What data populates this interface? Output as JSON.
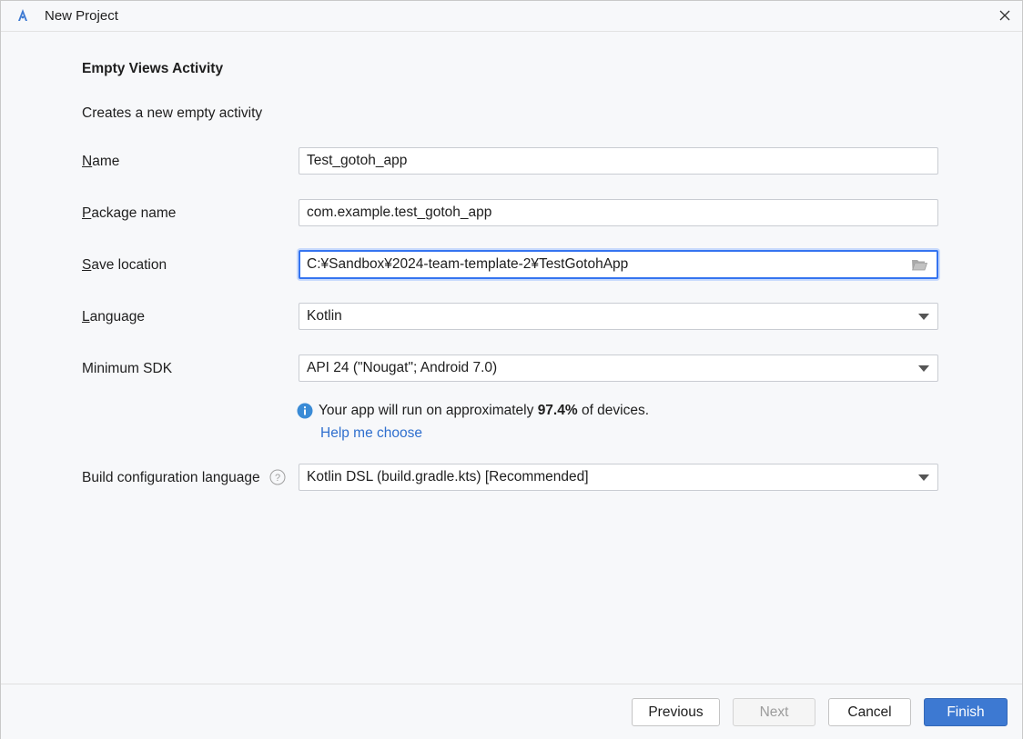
{
  "window": {
    "title": "New Project"
  },
  "content": {
    "heading": "Empty Views Activity",
    "description": "Creates a new empty activity"
  },
  "form": {
    "name": {
      "label_mnemonic": "N",
      "label_rest": "ame",
      "value": "Test_gotoh_app"
    },
    "package": {
      "label_mnemonic": "P",
      "label_rest": "ackage name",
      "value": "com.example.test_gotoh_app"
    },
    "save_location": {
      "label_mnemonic": "S",
      "label_rest": "ave location",
      "value": "C:¥Sandbox¥2024-team-template-2¥TestGotohApp",
      "icon": "folder-icon"
    },
    "language": {
      "label_mnemonic": "L",
      "label_rest": "anguage",
      "value": "Kotlin"
    },
    "min_sdk": {
      "label": "Minimum SDK",
      "value": "API 24 (\"Nougat\"; Android 7.0)"
    },
    "sdk_info": {
      "prefix": "Your app will run on approximately ",
      "percent": "97.4%",
      "suffix": " of devices.",
      "help_link": "Help me choose"
    },
    "build_config": {
      "label": "Build configuration language",
      "value": "Kotlin DSL (build.gradle.kts) [Recommended]"
    }
  },
  "footer": {
    "previous": "Previous",
    "next": "Next",
    "cancel": "Cancel",
    "finish": "Finish"
  },
  "colors": {
    "accent": "#3574f0",
    "primary_button": "#3d79d2",
    "link": "#2f6fce",
    "info_icon": "#3a8bd6"
  }
}
